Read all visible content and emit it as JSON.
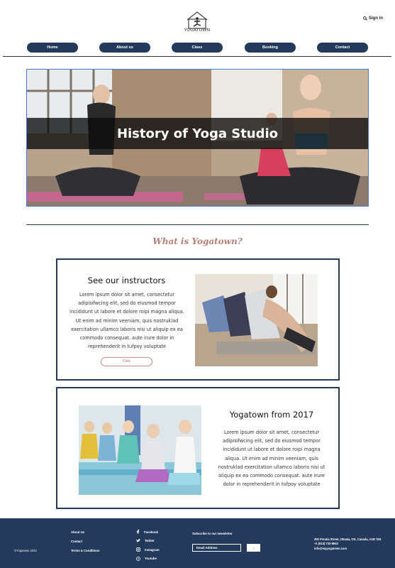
{
  "header": {
    "logo_text": "YOGATOWN",
    "signin_label": "Sign in"
  },
  "nav": [
    {
      "label": "Home"
    },
    {
      "label": "About us"
    },
    {
      "label": "Class"
    },
    {
      "label": "Booking"
    },
    {
      "label": "Contact"
    }
  ],
  "hero": {
    "title": "History of Yoga Studio"
  },
  "section": {
    "heading": "What is Yogatown?"
  },
  "card1": {
    "title": "See our instructors",
    "body": "Lorem ipsum dolor sit amet, consectetur adipisifwcing elit, sed do eiusmod tempor incididunt ut labore et dolore roipi magna aliqua. Ut enim ad minim veeniam, quis nostruklad exercitation ullamco laboris nisi ut aliquip ex ea commodo consequat. aute irure dolor in reprehenderit in tufpoy voluptate",
    "button_label": "Click"
  },
  "card2": {
    "title": "Yogatown from 2017",
    "body": "Lorem ipsum dolor sit amet, consectetur adipisifwcing elit, sed do eiusmod tempor incididunt ut labore et dolore roipi magna aliqua. Ut enim ad minim veeniam, quis nostruklad exercitation ullamco laboris nisi ut aliquip ex ea commodo consequat. aute irure dolor in reprehenderit in tufpoy voluptate"
  },
  "footer": {
    "copyright": "©Yogatown 2020",
    "links": [
      "About Us",
      "Contact",
      "Terms & Conditions"
    ],
    "social": [
      {
        "label": "Facebook",
        "icon": "facebook-icon"
      },
      {
        "label": "Twitter",
        "icon": "twitter-icon"
      },
      {
        "label": "Instagram",
        "icon": "instagram-icon"
      },
      {
        "label": "Youtube",
        "icon": "youtube-icon"
      }
    ],
    "newsletter_label": "Subscribe to our newsletter",
    "email_placeholder": "Email Address",
    "submit_label": "→",
    "address": "300 Prestia Street, Ottawa, Ott, Canada, A1B 7E8",
    "phone": "+1   (613) 733-8943",
    "email": "info@myyogatown.com"
  },
  "colors": {
    "navy": "#233a5c",
    "accent": "#b5807a",
    "hero_border": "#4a7fd0"
  }
}
